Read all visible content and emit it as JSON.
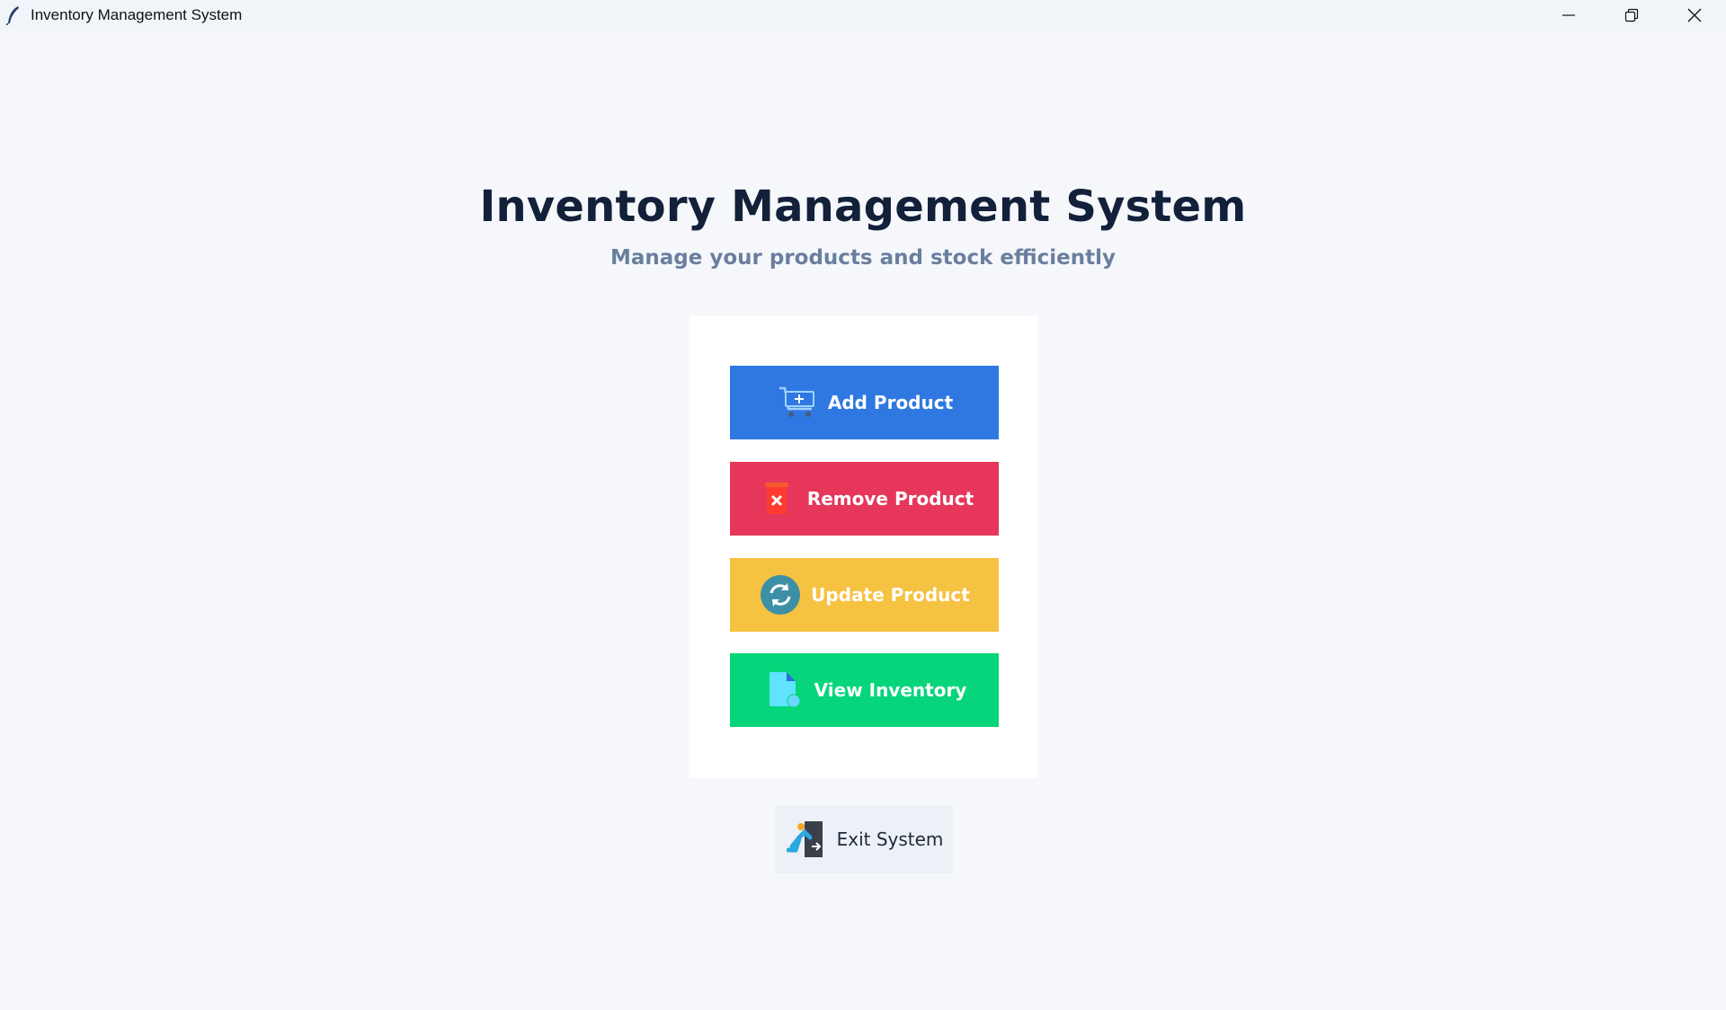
{
  "window": {
    "title": "Inventory Management System",
    "controls": [
      "minimize-icon",
      "restore-icon",
      "close-icon"
    ]
  },
  "main": {
    "title": "Inventory Management System",
    "subtitle": "Manage your products and stock efficiently"
  },
  "actions": [
    {
      "label": "Add Product",
      "icon": "cart-add-icon",
      "color": "#2f78e1"
    },
    {
      "label": "Remove Product",
      "icon": "trash-remove-icon",
      "color": "#e6375a"
    },
    {
      "label": "Update Product",
      "icon": "refresh-icon",
      "color": "#f6c242"
    },
    {
      "label": "View Inventory",
      "icon": "document-view-icon",
      "color": "#06d57b"
    }
  ],
  "exit": {
    "label": "Exit System",
    "icon": "exit-run-icon"
  },
  "colors": {
    "background": "#f5f7fb",
    "title": "#132039",
    "subtitle": "#6a7f9e"
  }
}
